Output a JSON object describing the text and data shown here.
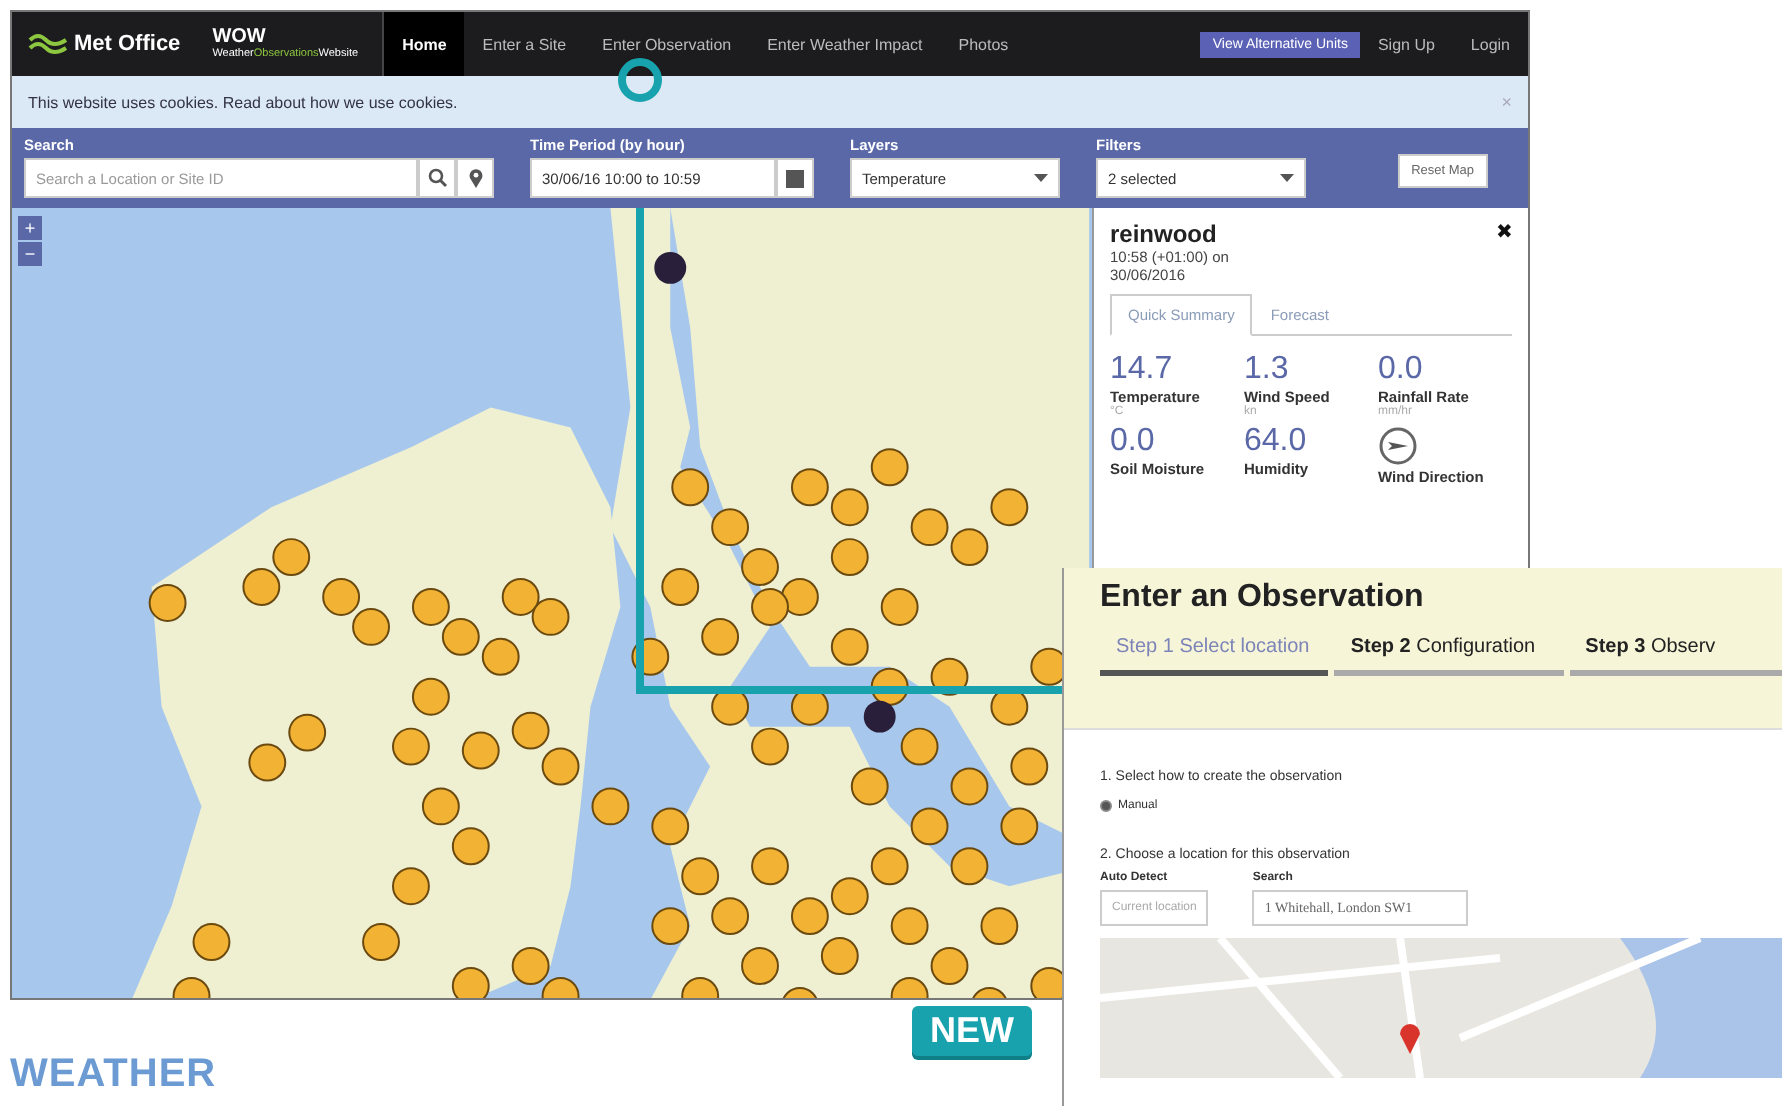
{
  "nav": {
    "logo": "Met Office",
    "wow_title": "WOW",
    "wow_subtitle": [
      "Weather",
      "Observations",
      "Website"
    ],
    "items": [
      {
        "label": "Home",
        "selected": true
      },
      {
        "label": "Enter a Site",
        "selected": false
      },
      {
        "label": "Enter Observation",
        "selected": false
      },
      {
        "label": "Enter Weather Impact",
        "selected": false
      },
      {
        "label": "Photos",
        "selected": false
      }
    ],
    "alt_units_button": "View Alternative Units",
    "sign_up": "Sign Up",
    "login": "Login"
  },
  "cookie_bar": {
    "text": "This website uses cookies. Read about how we use cookies.",
    "close": "×"
  },
  "filter_bar": {
    "search_label": "Search",
    "search_placeholder": "Search a Location or Site ID",
    "time_label": "Time Period (by hour)",
    "time_value": "30/06/16 10:00 to 10:59",
    "layers_label": "Layers",
    "layers_value": "Temperature",
    "filters_label": "Filters",
    "filters_value": "2 selected",
    "reset_button": "Reset Map"
  },
  "map_controls": [
    "+",
    "−"
  ],
  "site_panel": {
    "name": "reinwood",
    "time": "10:58 (+01:00) on 30/06/2016",
    "close": "✖",
    "tabs": [
      {
        "label": "Quick Summary",
        "selected": true
      },
      {
        "label": "Forecast",
        "selected": false
      }
    ],
    "metrics": [
      {
        "kind": "value",
        "value": "14.7",
        "label": "Temperature",
        "unit": "°C"
      },
      {
        "kind": "value",
        "value": "1.3",
        "label": "Wind Speed",
        "unit": "kn"
      },
      {
        "kind": "value",
        "value": "0.0",
        "label": "Rainfall Rate",
        "unit": "mm/hr"
      },
      {
        "kind": "value",
        "value": "0.0",
        "label": "Soil Moisture"
      },
      {
        "kind": "value",
        "value": "64.0",
        "label": "Humidity"
      },
      {
        "kind": "direction",
        "label": "Wind Direction"
      }
    ]
  },
  "observation_panel": {
    "title": "Enter an Observation",
    "steps": [
      {
        "number": "Step 1",
        "label": "Select location",
        "selected": true
      },
      {
        "number": "Step 2",
        "label": "Configuration",
        "selected": false
      },
      {
        "number": "Step 3",
        "label": "Observ",
        "selected": false
      }
    ],
    "section_1": "1. Select how to create the observation",
    "option": {
      "label": "Manual",
      "checked": true
    },
    "section_2": "2. Choose a location for this observation",
    "auto_detect_label": "Auto Detect",
    "current_location_button": "Current location",
    "search_label": "Search",
    "search_value": "1 Whitehall, London SW1"
  },
  "badge": "NEW",
  "heading": "WEATHER"
}
